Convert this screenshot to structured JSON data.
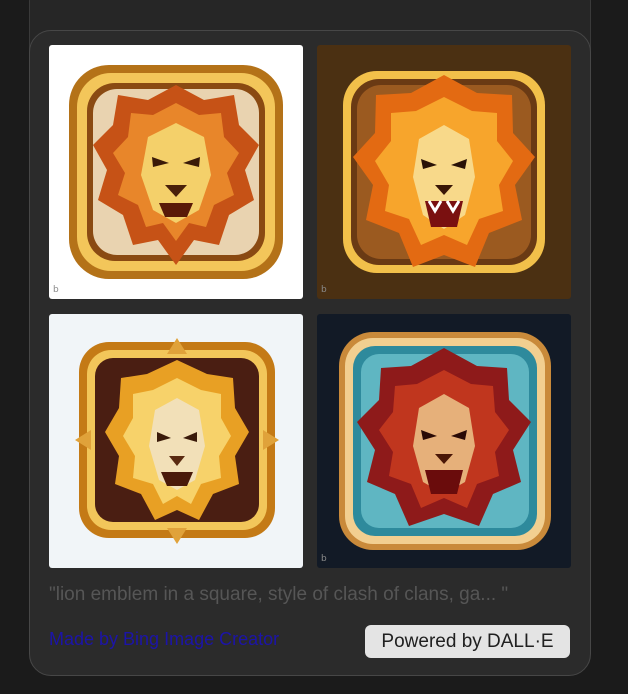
{
  "caption": "\"lion emblem in a square, style of clash of clans, ga...  \"",
  "made_by_link": "Made by Bing Image Creator",
  "powered_badge": "Powered by DALL·E",
  "watermark_glyph": "b",
  "images": [
    {
      "name": "lion-icon-gold-frame",
      "background": "#ffffff"
    },
    {
      "name": "lion-icon-roaring-brown",
      "background": "#4b3012"
    },
    {
      "name": "lion-icon-ornate-gold",
      "background": "#f1f5f8"
    },
    {
      "name": "lion-icon-teal-frame",
      "background": "#121a26"
    }
  ]
}
